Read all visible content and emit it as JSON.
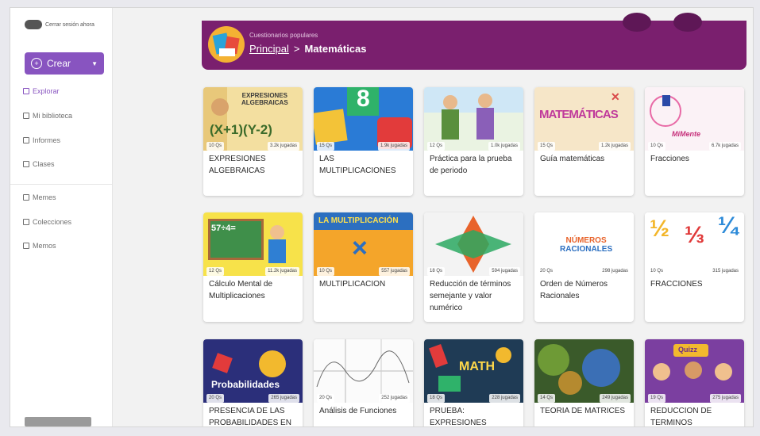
{
  "sidebar": {
    "signout": "Cerrar sesión ahora",
    "create_label": "Crear",
    "items": [
      {
        "label": "Explorar",
        "active": true
      },
      {
        "label": "Mi biblioteca"
      },
      {
        "label": "Informes"
      },
      {
        "label": "Clases"
      },
      {
        "label": "Memes"
      },
      {
        "label": "Colecciones"
      },
      {
        "label": "Memos"
      }
    ]
  },
  "banner": {
    "subtitle": "Cuestionarios populares",
    "breadcrumb_root": "Principal",
    "separator": ">",
    "breadcrumb_current": "Matemáticas"
  },
  "cards": [
    {
      "title": "EXPRESIONES ALGEBRAICAS",
      "qs": "10 Qs",
      "plays": "3.2k jugadas"
    },
    {
      "title": "LAS MULTIPLICACIONES",
      "qs": "15 Qs",
      "plays": "1.9k jugadas"
    },
    {
      "title": "Práctica para la prueba de periodo",
      "qs": "12 Qs",
      "plays": "1.0k jugadas"
    },
    {
      "title": "Guía matemáticas",
      "qs": "15 Qs",
      "plays": "1.2k jugadas"
    },
    {
      "title": "Fracciones",
      "qs": "10 Qs",
      "plays": "6.7k jugadas"
    },
    {
      "title": "Cálculo Mental de Multiplicaciones",
      "qs": "12 Qs",
      "plays": "11.2k jugadas"
    },
    {
      "title": "MULTIPLICACION",
      "qs": "10 Qs",
      "plays": "557 jugadas"
    },
    {
      "title": "Reducción de términos semejante y valor numérico",
      "qs": "18 Qs",
      "plays": "594 jugadas"
    },
    {
      "title": "Orden de Números Racionales",
      "qs": "20 Qs",
      "plays": "298 jugadas"
    },
    {
      "title": "FRACCIONES",
      "qs": "10 Qs",
      "plays": "315 jugadas"
    },
    {
      "title": "PRESENCIA DE LAS PROBABILIDADES EN",
      "qs": "20 Qs",
      "plays": "265 jugadas"
    },
    {
      "title": "Análisis de Funciones",
      "qs": "20 Qs",
      "plays": "252 jugadas"
    },
    {
      "title": "PRUEBA: EXPRESIONES",
      "qs": "18 Qs",
      "plays": "228 jugadas"
    },
    {
      "title": "TEORIA DE MATRICES",
      "qs": "14 Qs",
      "plays": "249 jugadas"
    },
    {
      "title": "REDUCCION DE TERMINOS",
      "qs": "19 Qs",
      "plays": "275 jugadas"
    }
  ],
  "thumb_texts": {
    "c1a": "EXPRESIONES",
    "c1b": "ALGEBRAICAS",
    "c1c": "(X+1)(Y-2)",
    "c2a": "8",
    "c4a": "MATEMÁTICAS",
    "c5a": "MiMente",
    "c7a": "LA MULTIPLICACIÓN",
    "c9a": "NÚMEROS",
    "c9b": "RACIONALES",
    "c11a": "Probabilidades",
    "c13a": "MATH",
    "c15a": "Quizz"
  },
  "colors": {
    "accent": "#8854c0",
    "banner": "#7a1f6e"
  }
}
